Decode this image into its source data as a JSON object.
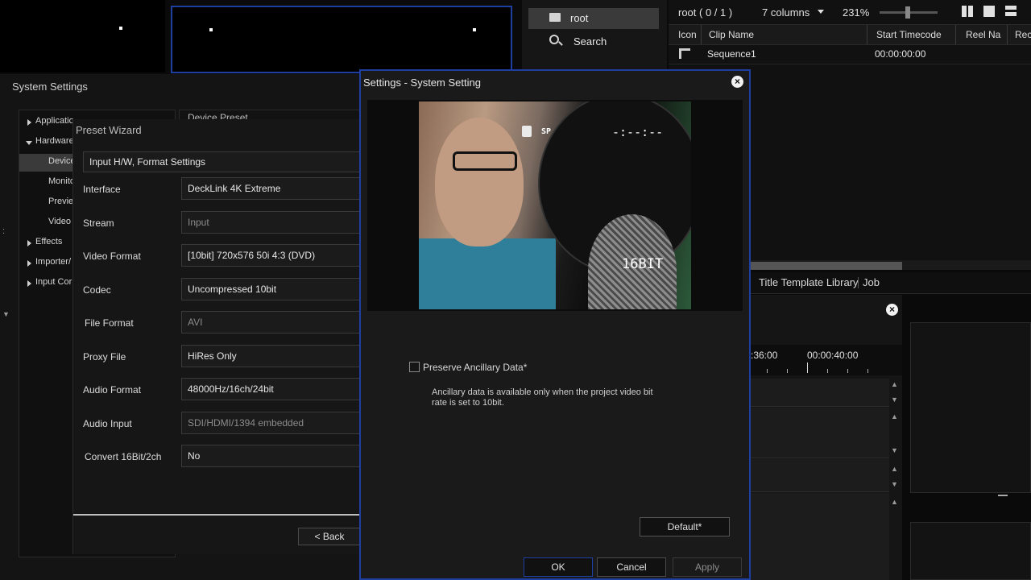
{
  "browser": {
    "folder_root": "root",
    "folder_search": "Search",
    "path": "root ( 0 / 1 )",
    "columns_label": "7 columns",
    "zoom": "231%",
    "headers": [
      "Icon",
      "Clip Name",
      "Start Timecode",
      "Reel Na",
      "Rec"
    ],
    "rows": [
      {
        "clip_name": "Sequence1",
        "start_timecode": "00:00:00:00"
      }
    ]
  },
  "bottom_tabs": {
    "title_template_library": "Title Template Library",
    "job": "Job"
  },
  "timeline": {
    "tc1": ":36:00",
    "tc2": "00:00:40:00"
  },
  "system_settings": {
    "title": "System Settings",
    "tree": [
      {
        "label": "Applicatio",
        "kind": "collapsed"
      },
      {
        "label": "Hardware",
        "kind": "expanded"
      },
      {
        "label": "Device",
        "kind": "child",
        "selected": true
      },
      {
        "label": "Monito",
        "kind": "child"
      },
      {
        "label": "Previe",
        "kind": "child"
      },
      {
        "label": "Video",
        "kind": "child"
      },
      {
        "label": "Effects",
        "kind": "collapsed"
      },
      {
        "label": "Importer/",
        "kind": "collapsed"
      },
      {
        "label": "Input Cor",
        "kind": "collapsed"
      }
    ],
    "device_preset_partial": "Device Preset"
  },
  "preset_wizard": {
    "title": "Preset Wizard",
    "header_field": "Input H/W, Format Settings",
    "rows": [
      {
        "label": "Interface",
        "value": "DeckLink 4K Extreme",
        "dim": false
      },
      {
        "label": "Stream",
        "value": "Input",
        "dim": true
      },
      {
        "label": "Video Format",
        "value": "[10bit] 720x576 50i 4:3 (DVD)",
        "dim": false
      },
      {
        "label": "Codec",
        "value": "Uncompressed 10bit",
        "dim": false
      },
      {
        "label": "File Format",
        "value": "AVI",
        "dim": true
      },
      {
        "label": "Proxy File",
        "value": "HiRes Only",
        "dim": false
      },
      {
        "label": "Audio Format",
        "value": "48000Hz/16ch/24bit",
        "dim": false
      },
      {
        "label": "Audio Input",
        "value": "SDI/HDMI/1394 embedded",
        "dim": true
      },
      {
        "label": "Convert 16Bit/2ch",
        "value": "No",
        "dim": false
      }
    ],
    "back_button": "< Back"
  },
  "dialog": {
    "title": "Settings - System Setting",
    "preview_overlay": {
      "tc": "-:--:--",
      "bit": "16BIT",
      "tape": "SP"
    },
    "checkbox_label": "Preserve Ancillary Data*",
    "checkbox_checked": false,
    "note_line1": "Ancillary data is available only when the project video bit",
    "note_line2": "rate is set to 10bit.",
    "default_button": "Default*",
    "ok_button": "OK",
    "cancel_button": "Cancel",
    "apply_button": "Apply",
    "accent_color": "#1f3fa0"
  }
}
